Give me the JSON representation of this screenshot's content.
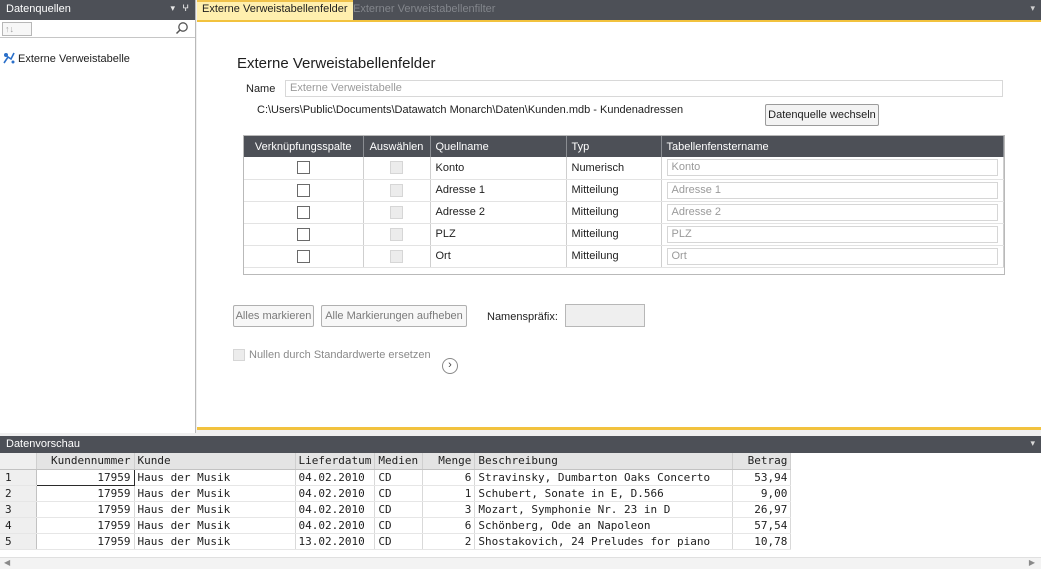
{
  "left_panel": {
    "title": "Datenquellen",
    "pin_symbol": "▾ ⎐",
    "sort_label": "↑↓",
    "items": [
      {
        "label": "Externe Verweistabelle"
      }
    ]
  },
  "tabs": [
    {
      "label": "Externe Verweistabellenfelder",
      "active": true
    },
    {
      "label": "Externer Verweistabellenfilter",
      "active": false
    }
  ],
  "main": {
    "title": "Externe Verweistabellenfelder",
    "name_label": "Name",
    "name_value": "Externe Verweistabelle",
    "path": "C:\\Users\\Public\\Documents\\Datawatch Monarch\\Daten\\Kunden.mdb - Kundenadressen",
    "change_source_button": "Datenquelle wechseln",
    "field_table": {
      "headers": [
        "Verknüpfungsspalte",
        "Auswählen",
        "Quellname",
        "Typ",
        "Tabellenfenstername"
      ],
      "rows": [
        {
          "source": "Konto",
          "type": "Numerisch",
          "table_name": "Konto"
        },
        {
          "source": "Adresse 1",
          "type": "Mitteilung",
          "table_name": "Adresse 1"
        },
        {
          "source": "Adresse 2",
          "type": "Mitteilung",
          "table_name": "Adresse 2"
        },
        {
          "source": "PLZ",
          "type": "Mitteilung",
          "table_name": "PLZ"
        },
        {
          "source": "Ort",
          "type": "Mitteilung",
          "table_name": "Ort"
        }
      ]
    },
    "select_all_button": "Alles markieren",
    "deselect_all_button": "Alle Markierungen aufheben",
    "prefix_label": "Namenspräfix:",
    "prefix_value": "",
    "null_checkbox_label": "Nullen durch Standardwerte ersetzen"
  },
  "preview": {
    "title": "Datenvorschau",
    "columns": [
      "Kundennummer",
      "Kunde",
      "Lieferdatum",
      "Medien",
      "Menge",
      "Beschreibung",
      "Betrag"
    ],
    "rows": [
      [
        "1",
        "17959",
        "Haus der Musik",
        "04.02.2010",
        "CD",
        "6",
        "Stravinsky, Dumbarton Oaks Concerto",
        "53,94"
      ],
      [
        "2",
        "17959",
        "Haus der Musik",
        "04.02.2010",
        "CD",
        "1",
        "Schubert, Sonate in E, D.566",
        "9,00"
      ],
      [
        "3",
        "17959",
        "Haus der Musik",
        "04.02.2010",
        "CD",
        "3",
        "Mozart, Symphonie Nr. 23 in D",
        "26,97"
      ],
      [
        "4",
        "17959",
        "Haus der Musik",
        "04.02.2010",
        "CD",
        "6",
        "Schönberg, Ode an Napoleon",
        "57,54"
      ],
      [
        "5",
        "17959",
        "Haus der Musik",
        "13.02.2010",
        "CD",
        "2",
        "Shostakovich, 24 Preludes for piano",
        "10,78"
      ]
    ]
  },
  "colors": {
    "accent": "#f2c23e",
    "header_dark": "#4d5057",
    "active_tab": "#ffefae"
  }
}
